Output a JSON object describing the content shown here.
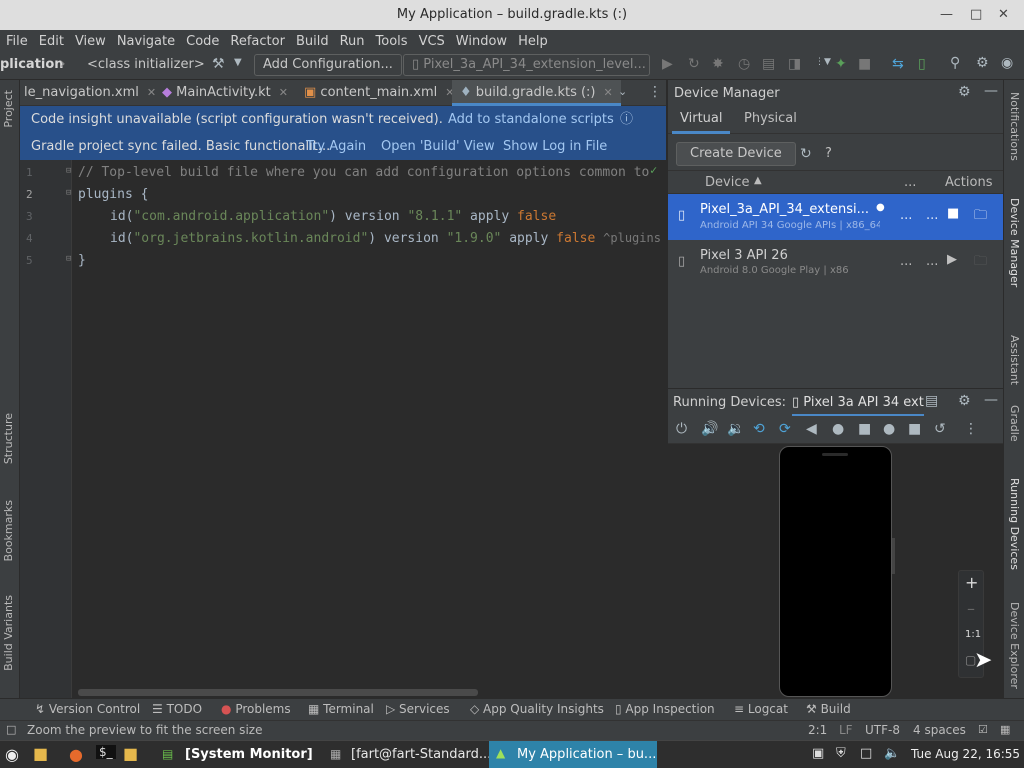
{
  "window": {
    "title": "My Application – build.gradle.kts (:)"
  },
  "menu": [
    "File",
    "Edit",
    "View",
    "Navigate",
    "Code",
    "Refactor",
    "Build",
    "Run",
    "Tools",
    "VCS",
    "Window",
    "Help"
  ],
  "toolbar": {
    "project_crumb": "plication",
    "class_crumb": "<class initializer>",
    "add_config": "Add Configuration...",
    "device_select": "Pixel_3a_API_34_extension_level..."
  },
  "left_stripe": [
    "Project",
    "Structure",
    "Bookmarks",
    "Build Variants"
  ],
  "right_stripe": [
    "Notifications",
    "Device Manager",
    "Assistant",
    "Gradle",
    "Running Devices",
    "Device Explorer"
  ],
  "tabs": [
    {
      "label": "le_navigation.xml"
    },
    {
      "label": "MainActivity.kt"
    },
    {
      "label": "content_main.xml"
    },
    {
      "label": "build.gradle.kts (:)"
    }
  ],
  "banners": {
    "insight": "Code insight unavailable (script configuration wasn't received).",
    "insight_link": "Add to standalone scripts",
    "sync": "Gradle project sync failed. Basic functionalit...",
    "try_again": "Try Again",
    "open_build": "Open 'Build' View",
    "show_log": "Show Log in File Manager"
  },
  "editor": {
    "line_numbers": [
      "1",
      "2",
      "3",
      "4",
      "5"
    ],
    "l1": "// Top-level build file where you can add configuration options common to",
    "l2": "plugins {",
    "l3_id": "id(",
    "l3_str": "\"com.android.application\"",
    "l3_mid": ") version ",
    "l3_ver": "\"8.1.1\"",
    "l3_apply": " apply ",
    "l3_false": "false",
    "l4_id": "id(",
    "l4_str": "\"org.jetbrains.kotlin.android\"",
    "l4_mid": ") version ",
    "l4_ver": "\"1.9.0\"",
    "l4_apply": " apply ",
    "l4_false": "false",
    "l4_hint": "^plugins",
    "l5": "}"
  },
  "device_manager": {
    "title": "Device Manager",
    "tab_virtual": "Virtual",
    "tab_physical": "Physical",
    "create_device": "Create Device",
    "col_device": "Device",
    "col_more": "...",
    "col_actions": "Actions",
    "devices": [
      {
        "name": "Pixel_3a_API_34_extensi...",
        "sub": "Android API 34 Google APIs | x86_64"
      },
      {
        "name": "Pixel 3 API 26",
        "sub": "Android 8.0 Google Play | x86"
      }
    ]
  },
  "running_devices": {
    "label": "Running Devices:",
    "tab": "Pixel 3a API 34 ext",
    "zoom_reset": "1:1"
  },
  "tool_windows": [
    "Version Control",
    "TODO",
    "Problems",
    "Terminal",
    "Services",
    "App Quality Insights",
    "App Inspection",
    "Logcat",
    "Build"
  ],
  "status": {
    "message": "Zoom the preview to fit the screen size",
    "pos": "2:1",
    "lf": "LF",
    "enc": "UTF-8",
    "indent": "4 spaces"
  },
  "taskbar": {
    "items": [
      "[System Monitor]",
      "[fart@fart-Standard...",
      "My Application – bu..."
    ],
    "clock": "Tue Aug 22, 16:55"
  },
  "colors": {
    "accent": "#4a88c7",
    "banner": "#28508a",
    "selection": "#2f65ca"
  }
}
